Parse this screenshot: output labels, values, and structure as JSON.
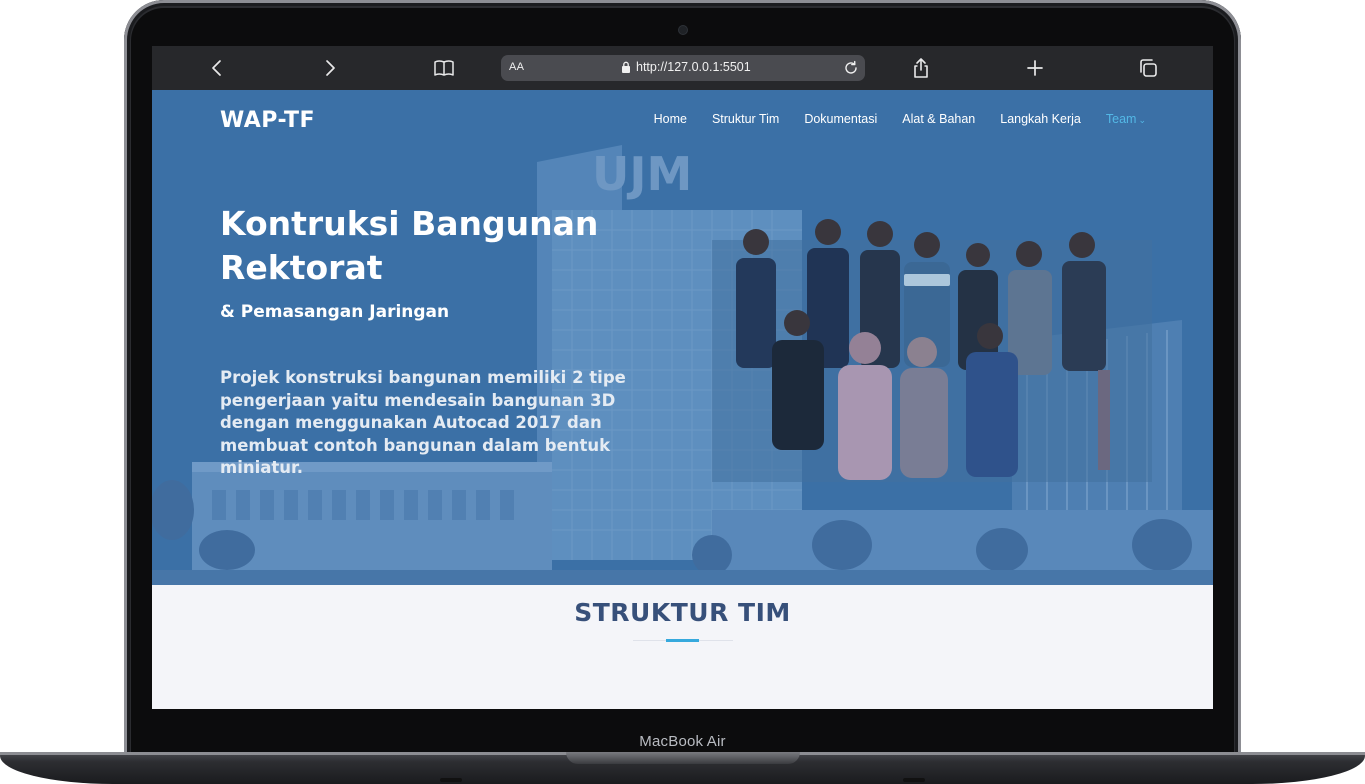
{
  "device": {
    "model_label": "MacBook Air"
  },
  "browser": {
    "text_size_label": "AA",
    "url": "http://127.0.0.1:5501",
    "icons": [
      "back-icon",
      "forward-icon",
      "bookmarks-icon",
      "lock-icon",
      "reload-icon",
      "share-icon",
      "new-tab-icon",
      "tabs-icon"
    ],
    "toolbar_color": "#27282b"
  },
  "site": {
    "logo": "WAP-TF",
    "nav": [
      {
        "label": "Home"
      },
      {
        "label": "Struktur Tim"
      },
      {
        "label": "Dokumentasi"
      },
      {
        "label": "Alat & Bahan"
      },
      {
        "label": "Langkah Kerja"
      },
      {
        "label": "Team",
        "dropdown": true
      }
    ],
    "hero": {
      "title": "Kontruksi Bangunan Rektorat",
      "subtitle": "& Pemasangan Jaringan",
      "description": "Projek konstruksi bangunan memiliki 2 tipe pengerjaan yaitu mendesain bangunan 3D dengan menggunakan Autocad 2017 dan membuat contoh bangunan dalam bentuk miniatur.",
      "background_text": "UJM"
    },
    "section": {
      "title": "STRUKTUR TIM"
    },
    "colors": {
      "accent": "#36a9dd",
      "nav_active": "#53b8e6",
      "section_title": "#37507a",
      "hero_overlay": "#3b72a6"
    }
  }
}
